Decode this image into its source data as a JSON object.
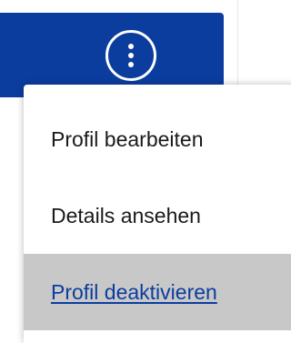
{
  "header": {
    "accent_color": "#0b3d9f",
    "more_button_icon": "kebab-vertical-icon"
  },
  "menu": {
    "items": [
      {
        "label": "Profil bearbeiten",
        "state": "default"
      },
      {
        "label": "Details ansehen",
        "state": "default"
      },
      {
        "label": "Profil deaktivieren",
        "state": "hovered",
        "highlight_color": "#c8c8c8",
        "text_color": "#0b3d9f"
      }
    ]
  }
}
